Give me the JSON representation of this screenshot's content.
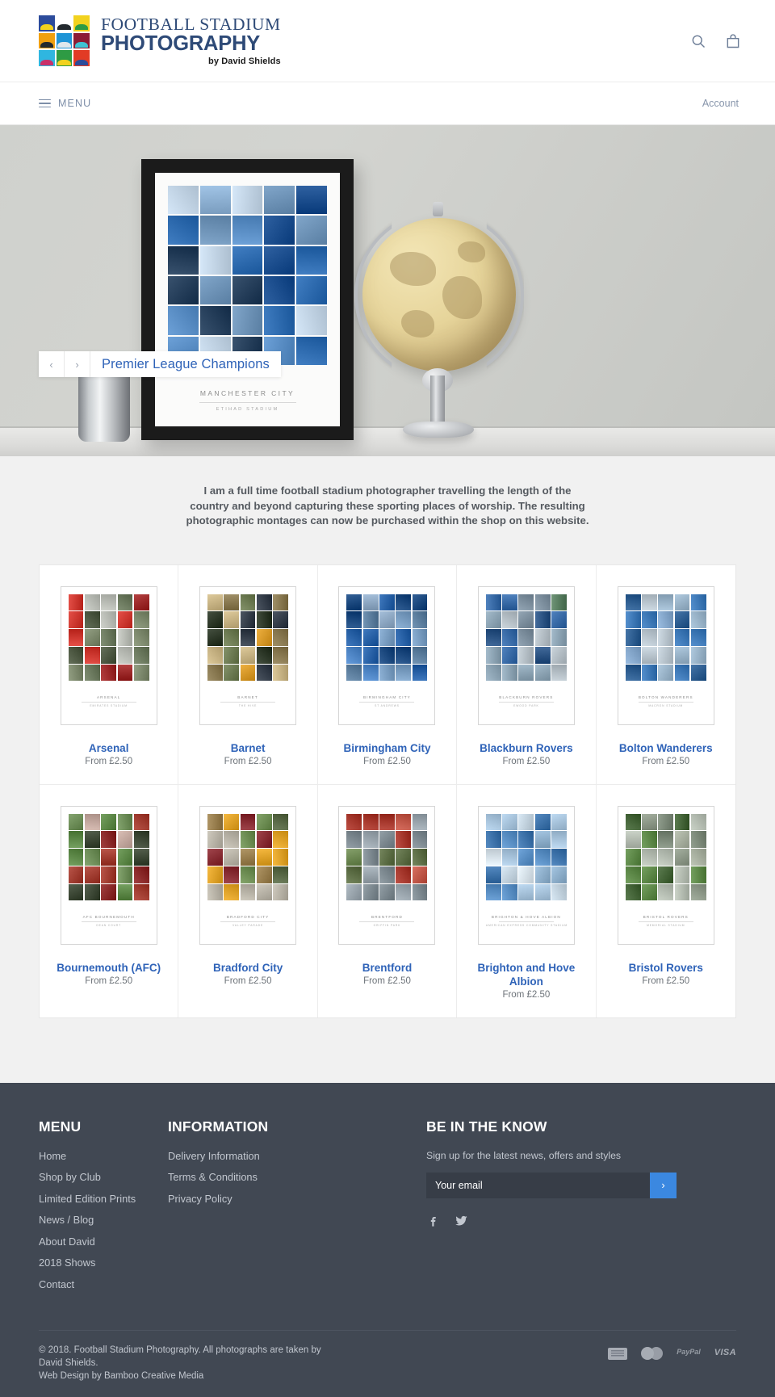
{
  "header": {
    "logo": {
      "line1": "FOOTBALL STADIUM",
      "line2": "PHOTOGRAPHY",
      "line3": "by David Shields",
      "tiles": [
        {
          "bg": "#2c4b9b",
          "stand": "#f2d21e"
        },
        {
          "bg": "#ffffff",
          "stand": "#23292e"
        },
        {
          "bg": "#f2d21e",
          "stand": "#2e9b44"
        },
        {
          "bg": "#f0a010",
          "stand": "#23292e"
        },
        {
          "bg": "#1f94d6",
          "stand": "#dfe7ec"
        },
        {
          "bg": "#8c1c35",
          "stand": "#3fc2d4"
        },
        {
          "bg": "#2fb6e0",
          "stand": "#c9306a"
        },
        {
          "bg": "#2e9b44",
          "stand": "#f2d21e"
        },
        {
          "bg": "#e23b25",
          "stand": "#2c4b9b"
        }
      ]
    },
    "search_icon": "search-icon",
    "bag_icon": "shopping-bag-icon"
  },
  "nav": {
    "menu_label": "MENU",
    "account_label": "Account"
  },
  "hero": {
    "prev_label": "‹",
    "next_label": "›",
    "title": "Premier League Champions",
    "poster_club": "MANCHESTER CITY",
    "poster_stadium": "ETIHAD STADIUM"
  },
  "intro": {
    "text": "I am a full time football stadium photographer travelling the length of the country and beyond capturing these sporting places of worship. The resulting photographic montages can now be purchased within the shop on this website."
  },
  "products": {
    "rows": [
      [
        {
          "title": "Arsenal",
          "price": "From £2.50",
          "poster_club": "ARSENAL",
          "poster_stadium": "EMIRATES STADIUM",
          "palette": [
            "#9e2b2b",
            "#7e8a6e",
            "#b9bcb5",
            "#cf3a32",
            "#6c7a5f",
            "#4f5a44"
          ]
        },
        {
          "title": "Barnet",
          "price": "From £2.50",
          "poster_club": "BARNET",
          "poster_stadium": "THE HIVE",
          "palette": [
            "#d89a2a",
            "#6f7d55",
            "#37404c",
            "#c8b485",
            "#8a7a52",
            "#2f3a2a"
          ]
        },
        {
          "title": "Birmingham City",
          "price": "From £2.50",
          "poster_club": "BIRMINGHAM CITY",
          "poster_stadium": "ST ANDREWS",
          "palette": [
            "#2a63a8",
            "#4f86c6",
            "#8fa9c4",
            "#1d4a80",
            "#7a9ec2",
            "#5d7f9f"
          ]
        },
        {
          "title": "Blackburn Rovers",
          "price": "From £2.50",
          "poster_club": "BLACKBURN ROVERS",
          "poster_stadium": "EWOOD PARK",
          "palette": [
            "#3a6ca8",
            "#7e909f",
            "#5a7f62",
            "#b5bfc6",
            "#2d5585",
            "#8ea5b5"
          ]
        },
        {
          "title": "Bolton Wanderers",
          "price": "From £2.50",
          "poster_club": "BOLTON WANDERERS",
          "poster_stadium": "MACRON STADIUM",
          "palette": [
            "#3f7ab8",
            "#86a8cc",
            "#6c8f70",
            "#bac6cf",
            "#2f5f92",
            "#9ab4c9"
          ]
        }
      ],
      [
        {
          "title": "Bournemouth (AFC)",
          "price": "From £2.50",
          "poster_club": "AFC BOURNEMOUTH",
          "poster_stadium": "DEAN COURT",
          "palette": [
            "#8b2a2a",
            "#5f8a4a",
            "#c4a9a0",
            "#a33f33",
            "#6f8f5a",
            "#3f4a38"
          ]
        },
        {
          "title": "Bradford City",
          "price": "From £2.50",
          "poster_club": "BRADFORD CITY",
          "poster_stadium": "VALLEY PARADE",
          "palette": [
            "#8a2f36",
            "#e0a32a",
            "#6f8f55",
            "#b9b4a8",
            "#5a6a48",
            "#9a8050"
          ]
        },
        {
          "title": "Brentford",
          "price": "From £2.50",
          "poster_club": "BRENTFORD",
          "poster_stadium": "GRIFFIN PARK",
          "palette": [
            "#a83a2f",
            "#6f8a55",
            "#9aa5ad",
            "#c2594a",
            "#5f7048",
            "#7e8a91"
          ]
        },
        {
          "title": "Brighton and Hove Albion",
          "price": "From £2.50",
          "poster_club": "BRIGHTON & HOVE ALBION",
          "poster_stadium": "AMERICAN EXPRESS COMMUNITY STADIUM",
          "palette": [
            "#5a8fc4",
            "#a8c4dc",
            "#d7e2ea",
            "#3f74ab",
            "#8fb0cc",
            "#c3d3df"
          ]
        },
        {
          "title": "Bristol Rovers",
          "price": "From £2.50",
          "poster_club": "BRISTOL ROVERS",
          "poster_stadium": "MEMORIAL STADIUM",
          "palette": [
            "#5f8a4a",
            "#8f9a8a",
            "#b5bdb2",
            "#46663a",
            "#7d8a7a",
            "#a8b0a0"
          ]
        }
      ]
    ]
  },
  "footer": {
    "menu_heading": "MENU",
    "menu_links": [
      "Home",
      "Shop by Club",
      "Limited Edition Prints",
      "News / Blog",
      "About David",
      "2018 Shows",
      "Contact"
    ],
    "info_heading": "INFORMATION",
    "info_links": [
      "Delivery Information",
      "Terms & Conditions",
      "Privacy Policy"
    ],
    "news_heading": "BE IN THE KNOW",
    "news_sub": "Sign up for the latest news, offers and styles",
    "email_placeholder": "Your email",
    "email_value": "",
    "submit_label": "›",
    "social": [
      "facebook-icon",
      "twitter-icon"
    ],
    "copyright_line1": "© 2018. Football Stadium Photography. All photographs are taken by David Shields.",
    "copyright_line2": "Web Design by Bamboo Creative Media",
    "payments": [
      "American Express",
      "Mastercard",
      "Paypal",
      "VISA"
    ],
    "paypal_label": "PayPal",
    "visa_label": "VISA",
    "accent_color": "#3b88e0",
    "background_color": "#414853"
  }
}
